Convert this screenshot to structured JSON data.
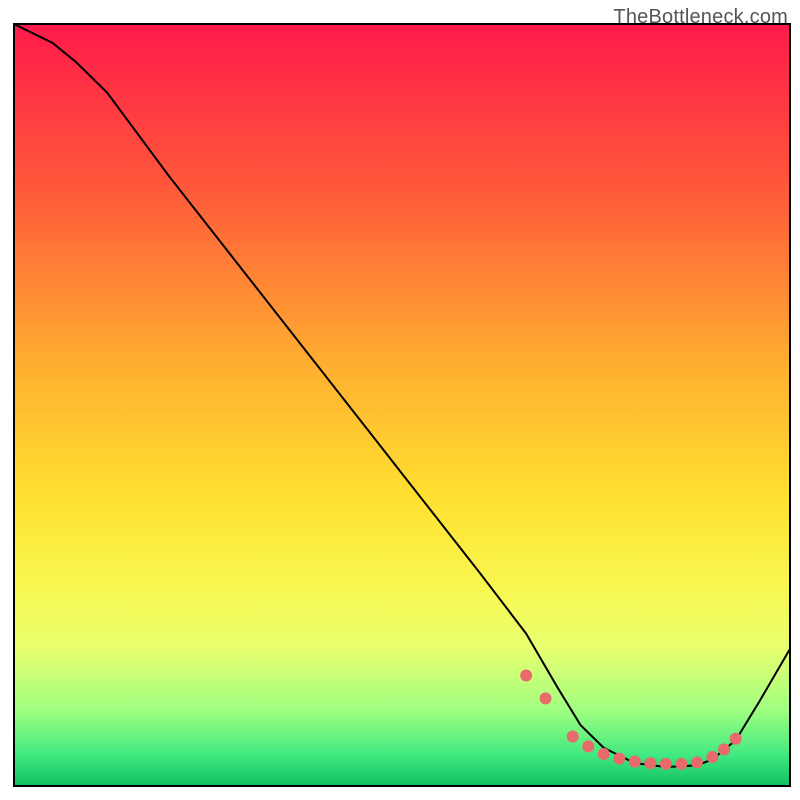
{
  "watermark": "TheBottleneck.com",
  "chart_data": {
    "type": "line",
    "title": "",
    "xlabel": "",
    "ylabel": "",
    "xlim": [
      0,
      100
    ],
    "ylim": [
      0,
      100
    ],
    "background": {
      "type": "vertical-gradient",
      "stops": [
        {
          "offset": 0,
          "color": "#ff1a4a"
        },
        {
          "offset": 22,
          "color": "#ff5a3a"
        },
        {
          "offset": 45,
          "color": "#ffb030"
        },
        {
          "offset": 62,
          "color": "#ffe030"
        },
        {
          "offset": 74,
          "color": "#f8f850"
        },
        {
          "offset": 82,
          "color": "#e8ff70"
        },
        {
          "offset": 90,
          "color": "#a0ff80"
        },
        {
          "offset": 96,
          "color": "#40e880"
        },
        {
          "offset": 100,
          "color": "#10c060"
        }
      ]
    },
    "series": [
      {
        "name": "bottleneck-curve",
        "color": "#000000",
        "stroke_width": 2,
        "x": [
          0,
          2,
          5,
          8,
          12,
          20,
          30,
          40,
          50,
          60,
          66,
          70,
          73,
          76,
          80,
          84,
          88,
          90,
          93,
          96,
          100
        ],
        "y": [
          100,
          99,
          97.5,
          95,
          91,
          80,
          67,
          54,
          41,
          28,
          20,
          13,
          8,
          5,
          3,
          2.5,
          2.7,
          3.5,
          6,
          11,
          18
        ]
      }
    ],
    "markers": {
      "name": "data-points",
      "color": "#e86a6a",
      "radius": 6,
      "x": [
        66,
        68.5,
        72,
        74,
        76,
        78,
        80,
        82,
        84,
        86,
        88,
        90,
        91.5,
        93
      ],
      "y": [
        14.5,
        11.5,
        6.5,
        5.2,
        4.2,
        3.6,
        3.2,
        3.0,
        2.9,
        2.9,
        3.1,
        3.8,
        4.8,
        6.2
      ]
    }
  }
}
